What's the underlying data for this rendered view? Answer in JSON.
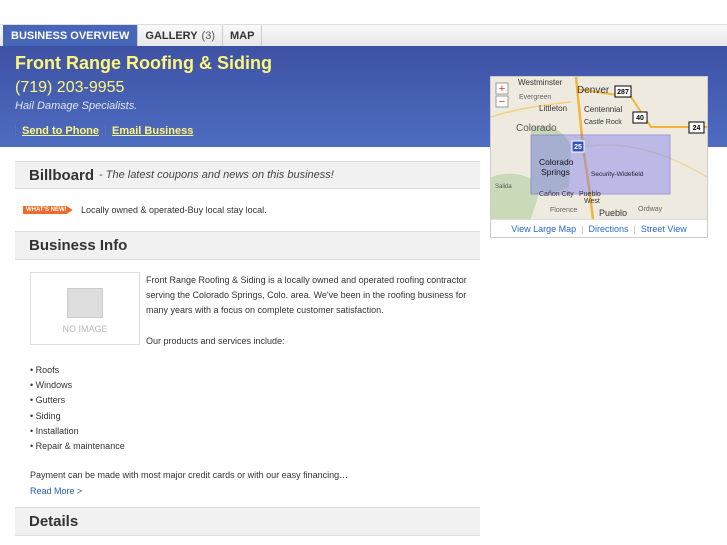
{
  "tabs": [
    {
      "label": "BUSINESS OVERVIEW"
    },
    {
      "label": "GALLERY",
      "count": "(3)"
    },
    {
      "label": "MAP"
    }
  ],
  "business": {
    "name": "Front Range Roofing & Siding",
    "phone": "(719) 203-9955",
    "tagline": "Hail Damage Specialists.",
    "links": [
      "Send to Phone",
      "Email Business"
    ]
  },
  "billboard": {
    "title": "Billboard",
    "subtitle": "- The latest coupons and news on this business!",
    "badge": "WHAT'S NEW!",
    "text": "Locally owned & operated-Buy local stay local."
  },
  "info": {
    "title": "Business Info",
    "no_image": "NO IMAGE",
    "description": "Front Range Roofing & Siding is a locally owned and operated roofing contractor serving the Colorado Springs, Colo. area. We've been in the roofing business for many years with a focus on complete customer satisfaction.",
    "products_intro": "Our products and services include:",
    "products": [
      "• Roofs",
      "• Windows",
      "• Gutters",
      "• Siding",
      "• Installation",
      "• Repair & maintenance"
    ],
    "payment": "Payment can be made with most major credit cards or with our easy financing…",
    "read_more": "Read More >"
  },
  "details": {
    "title": "Details"
  },
  "map": {
    "zoom_in": "+",
    "zoom_out": "−",
    "labels": [
      "Westminster",
      "Denver",
      "Evergreen",
      "Littleton",
      "Centennial",
      "Castle Rock",
      "Colorado",
      "Colorado Springs",
      "Security-Widefield",
      "Salida",
      "Cañon City",
      "Pueblo West",
      "Florence",
      "Pueblo",
      "Ordway"
    ],
    "shields": [
      "287",
      "40",
      "24",
      "25"
    ],
    "links": [
      "View Large Map",
      "Directions",
      "Street View"
    ]
  }
}
